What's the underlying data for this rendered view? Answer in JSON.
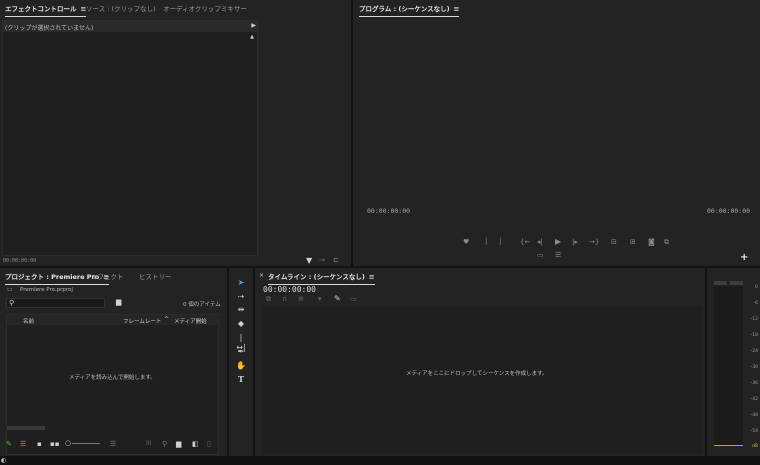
{
  "effect_panel": {
    "tabs": [
      "エフェクトコントロール",
      "ソース : (クリップなし)",
      "オーディオクリップミキサー"
    ],
    "menu_icon": "hamburger-icon",
    "no_clip_message": "(クリップが選択されていません)",
    "timecode": "00:00:00:00"
  },
  "program_monitor": {
    "title": "プログラム : (シーケンスなし)",
    "timecode_left": "00:00:00:00",
    "timecode_right": "00:00:00:00"
  },
  "project_panel": {
    "tabs": [
      "プロジェクト : Premiere Pro",
      "エフェクト",
      "ヒストリー"
    ],
    "file_name": "Premiere Pro.prproj",
    "item_count": "0 個のアイテム",
    "columns": [
      "名前",
      "フレームレート",
      "メディア開始"
    ],
    "empty_message": "メディアを読み込んで開始します。"
  },
  "timeline_panel": {
    "title": "タイムライン : (シーケンスなし)",
    "timecode": "00:00:00:00",
    "empty_message": "メディアをここにドロップしてシーケンスを作成します。"
  },
  "audio_meter": {
    "scale": [
      "0",
      "-6",
      "-12",
      "-18",
      "-24",
      "-30",
      "-36",
      "-42",
      "-48",
      "-54",
      "dB"
    ]
  },
  "colors": {
    "panel_bg": "#232323",
    "app_bg": "#121212",
    "accent_blue": "#4a9cf0",
    "accent_green": "#5fbf3a"
  }
}
